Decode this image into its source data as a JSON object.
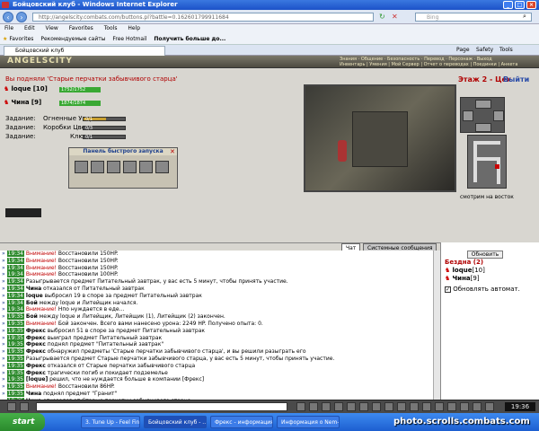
{
  "window": {
    "title": "Бойцовский клуб - Windows Internet Explorer"
  },
  "browser": {
    "url": "http://angelscity.combats.com/buttons.pl?battle=0.162601799911684",
    "search_placeholder": "Bing",
    "menu": [
      "File",
      "Edit",
      "View",
      "Favorites",
      "Tools",
      "Help"
    ],
    "favorites": [
      "Favorites",
      "Рекомендуемые сайты",
      "Free Hotmail",
      "Получить больше до..."
    ],
    "tab": "Бойцовский клуб",
    "tools": [
      "Page",
      "Safety",
      "Tools"
    ]
  },
  "game": {
    "logo": "ANGELSCITY",
    "top_menu": [
      "Знания",
      "Общение",
      "Безопасность",
      "Перевод",
      "Персонаж",
      "Выход",
      "Инвентарь",
      "Умения",
      "Мой Сервер",
      "Отчет о переводах",
      "Поединки",
      "Анкета"
    ],
    "status_text": "Вы подняли 'Старые перчатки забывчивого старца'",
    "players": [
      {
        "name": "loque",
        "level": "[10]",
        "hp": "1752/1752"
      },
      {
        "name": "Чина",
        "level": "[9]",
        "hp": "1874/1874"
      }
    ],
    "tasks": [
      {
        "label": "Задание:",
        "item": "Огненные Узоры",
        "value": "0/1",
        "progress": 0.55
      },
      {
        "label": "Задание:",
        "item": "Коробки Цветные",
        "value": "0/3",
        "progress": 0.0
      },
      {
        "label": "Задание:",
        "item": "Ключники",
        "value": "0/1",
        "progress": 0.0
      }
    ],
    "quick_panel": {
      "title": "Панель быстрого запуска",
      "close": "✕"
    },
    "location": {
      "floor": "Этаж 2 - Цех",
      "exit": "Выйти",
      "view": "смотрим на восток"
    },
    "chat_tabs": [
      "Чат",
      "Системные сообщения"
    ],
    "refresh_label": "Обновить",
    "side": {
      "group": "Бездна (2)",
      "members": [
        {
          "name": "loque",
          "level": "[10]"
        },
        {
          "name": "Чина",
          "level": "[9]"
        }
      ],
      "auto": "Обновлять автомат."
    },
    "chat": [
      {
        "t": "19:34",
        "w": "Внимание!",
        "text": "Восстановили 150HP."
      },
      {
        "t": "19:34",
        "w": "Внимание!",
        "text": "Восстановили 150HP."
      },
      {
        "t": "19:34",
        "w": "Внимание!",
        "text": "Восстановили 150HP."
      },
      {
        "t": "19:34",
        "w": "Внимание!",
        "text": "Восстановили 100HP."
      },
      {
        "t": "19:34",
        "text": "Разыгрывается предмет Питательный завтрак, у вас есть 5 минут, чтобы принять участие."
      },
      {
        "t": "19:34",
        "n": "Чина",
        "text": "отказался от Питательный завтрак"
      },
      {
        "t": "19:34",
        "n": "loque",
        "text": "выбросил 19 в споре за предмет Питательный завтрак"
      },
      {
        "t": "19:34",
        "n": "Бой",
        "text": "между loque и Литейщик начался."
      },
      {
        "t": "19:34",
        "w": "Внимание!",
        "text": "Нпо нуждается в еде..."
      },
      {
        "t": "19:35",
        "n": "Бой",
        "text": "между loque и Литейщик, Литейщик (1), Литейщик (2) закончен."
      },
      {
        "t": "19:35",
        "w": "Внимание!",
        "text": "Бой закончен. Всего вами нанесено урона: 2249 HP. Получено опыта: 0."
      },
      {
        "t": "19:35",
        "n": "Фрекс",
        "text": "выбросил 51 в споре за предмет Питательный завтрак"
      },
      {
        "t": "19:35",
        "n": "Фрекс",
        "text": "выиграл предмет Питательный завтрак"
      },
      {
        "t": "19:35",
        "n": "Фрекс",
        "text": "поднял предмет \"Питательный завтрак\""
      },
      {
        "t": "19:35",
        "n": "Фрекс",
        "text": "обнаружил предметы 'Старые перчатки забывчивого старца', и вы решили разыграть его"
      },
      {
        "t": "19:35",
        "text": "Разыгрывается предмет Старые перчатки забывчивого старца, у вас есть 5 минут, чтобы принять участие."
      },
      {
        "t": "19:35",
        "n": "Фрекс",
        "text": "отказался от Старые перчатки забывчивого старца"
      },
      {
        "t": "19:35",
        "n": "Фрекс",
        "text": "трагически погиб и покидает подземелье"
      },
      {
        "t": "19:35",
        "n": "[loque]",
        "text": "решил, что не нуждается больше в компании [Фрекс]"
      },
      {
        "t": "19:35",
        "w": "Внимание!",
        "text": "Восстановили 86HP."
      },
      {
        "t": "19:35",
        "n": "Чина",
        "text": "поднял предмет \"Гранит\""
      },
      {
        "t": "19:35",
        "n": "Чина",
        "text": "отказался от Старые перчатки забывчивого старца"
      }
    ],
    "clock": "19:36"
  },
  "taskbar": {
    "start": "start",
    "items": [
      "3. Tune Up - Feel Fin...",
      "Бойцовский клуб - ...",
      "Фрекс - информация...",
      "Информация о Nem-..."
    ],
    "watermark": "photo.scrolls.combats.com"
  }
}
